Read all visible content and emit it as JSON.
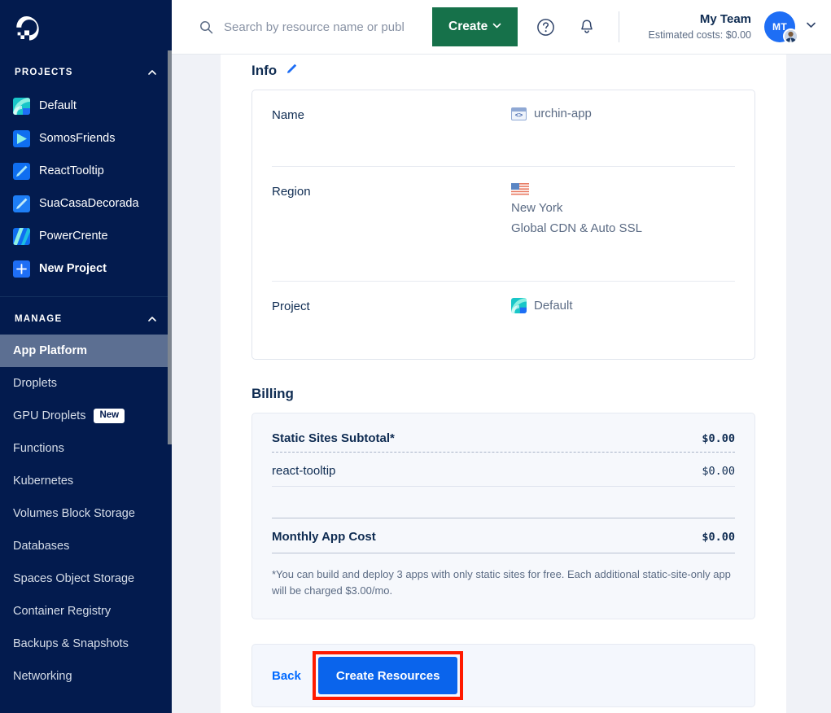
{
  "sidebar": {
    "logo_name": "digitalocean-logo",
    "projects_header": "PROJECTS",
    "manage_header": "MANAGE",
    "projects": [
      {
        "label": "Default",
        "icon": "project-default-icon"
      },
      {
        "label": "SomosFriends",
        "icon": "project-somosfriends-icon"
      },
      {
        "label": "ReactTooltip",
        "icon": "project-reacttooltip-icon"
      },
      {
        "label": "SuaCasaDecorada",
        "icon": "project-suacasadecorada-icon"
      },
      {
        "label": "PowerCrente",
        "icon": "project-powercrente-icon"
      },
      {
        "label": "New Project",
        "icon": "plus-icon"
      }
    ],
    "manage_items": [
      {
        "label": "App Platform",
        "active": true,
        "badge": ""
      },
      {
        "label": "Droplets",
        "active": false,
        "badge": ""
      },
      {
        "label": "GPU Droplets",
        "active": false,
        "badge": "New"
      },
      {
        "label": "Functions",
        "active": false,
        "badge": ""
      },
      {
        "label": "Kubernetes",
        "active": false,
        "badge": ""
      },
      {
        "label": "Volumes Block Storage",
        "active": false,
        "badge": ""
      },
      {
        "label": "Databases",
        "active": false,
        "badge": ""
      },
      {
        "label": "Spaces Object Storage",
        "active": false,
        "badge": ""
      },
      {
        "label": "Container Registry",
        "active": false,
        "badge": ""
      },
      {
        "label": "Backups & Snapshots",
        "active": false,
        "badge": ""
      },
      {
        "label": "Networking",
        "active": false,
        "badge": ""
      }
    ]
  },
  "topbar": {
    "search_placeholder": "Search by resource name or publ",
    "search_value": "",
    "create_label": "Create",
    "help_icon": "help-circle-icon",
    "bell_icon": "notification-bell-icon",
    "team_name": "My Team",
    "team_cost": "Estimated costs: $0.00",
    "avatar_initials": "MT"
  },
  "info": {
    "title": "Info",
    "edit_icon": "edit-pencil-icon",
    "rows": [
      {
        "key": "Name",
        "value": "urchin-app",
        "icon": "app-window-code-icon",
        "sub": ""
      },
      {
        "key": "Region",
        "value": "New York",
        "icon": "us-flag-icon",
        "sub": "Global CDN & Auto SSL"
      },
      {
        "key": "Project",
        "value": "Default",
        "icon": "project-default-icon",
        "sub": ""
      }
    ]
  },
  "billing": {
    "title": "Billing",
    "subtotal_label": "Static Sites Subtotal*",
    "subtotal_amount": "$0.00",
    "line_items": [
      {
        "label": "react-tooltip",
        "amount": "$0.00"
      }
    ],
    "total_label": "Monthly App Cost",
    "total_amount": "$0.00",
    "footnote": "*You can build and deploy 3 apps with only static sites for free. Each additional static-site-only app will be charged $3.00/mo."
  },
  "actions": {
    "back_label": "Back",
    "create_resources_label": "Create Resources"
  },
  "colors": {
    "sidebar_bg": "#031b4e",
    "accent_blue": "#0069ff",
    "create_green": "#16714a",
    "primary_button": "#0a64ec",
    "highlight_red": "#ff1a00"
  }
}
